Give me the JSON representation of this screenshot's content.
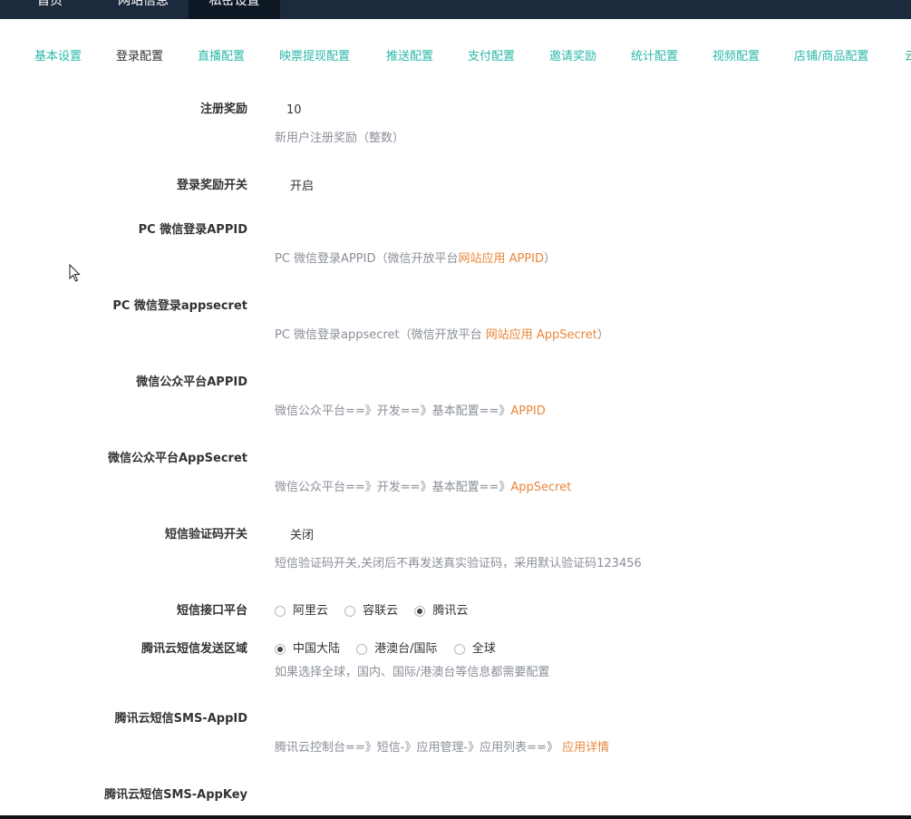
{
  "topnav": {
    "item1": "首页",
    "item2": "网站信息",
    "item3": "私密设置"
  },
  "subtabs": [
    "基本设置",
    "登录配置",
    "直播配置",
    "映票提现配置",
    "推送配置",
    "支付配置",
    "邀请奖励",
    "统计配置",
    "视频配置",
    "店铺/商品配置",
    "云"
  ],
  "form": {
    "reg_reward": {
      "label": "注册奖励",
      "value": "10",
      "help": "新用户注册奖励（整数）"
    },
    "login_reward": {
      "label": "登录奖励开关",
      "value": "开启"
    },
    "pc_wx_appid": {
      "label": "PC 微信登录APPID",
      "help_prefix": "PC 微信登录APPID（微信开放平台",
      "help_link": "网站应用 APPID",
      "help_suffix": "）"
    },
    "pc_wx_secret": {
      "label": "PC 微信登录appsecret",
      "help_prefix": "PC 微信登录appsecret（微信开放平台 ",
      "help_link": "网站应用 AppSecret",
      "help_suffix": "）"
    },
    "mp_appid": {
      "label": "微信公众平台APPID",
      "help_prefix": "微信公众平台==》开发==》基本配置==》",
      "help_link": "APPID"
    },
    "mp_secret": {
      "label": "微信公众平台AppSecret",
      "help_prefix": "微信公众平台==》开发==》基本配置==》",
      "help_link": "AppSecret"
    },
    "sms_switch": {
      "label": "短信验证码开关",
      "value": "关闭",
      "help": "短信验证码开关,关闭后不再发送真实验证码，采用默认验证码123456"
    },
    "sms_platform": {
      "label": "短信接口平台",
      "options": [
        "阿里云",
        "容联云",
        "腾讯云"
      ]
    },
    "tx_region": {
      "label": "腾讯云短信发送区域",
      "options": [
        "中国大陆",
        "港澳台/国际",
        "全球"
      ],
      "help": "如果选择全球，国内、国际/港澳台等信息都需要配置"
    },
    "tx_appid": {
      "label": "腾讯云短信SMS-AppID",
      "help_prefix": "腾讯云控制台==》短信-》应用管理-》应用列表==》 ",
      "help_link": "应用详情"
    },
    "tx_appkey": {
      "label": "腾讯云短信SMS-AppKey"
    }
  }
}
